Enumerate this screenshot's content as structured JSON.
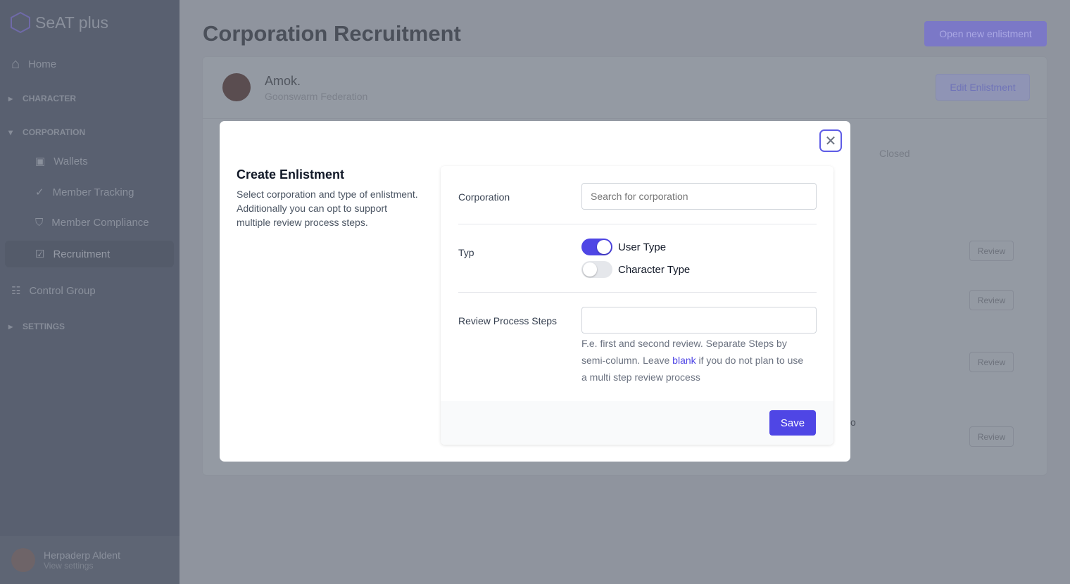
{
  "app": {
    "name": "SeAT plus",
    "accent": "#4f46e5"
  },
  "sidebar": {
    "home": "Home",
    "character": "CHARACTER",
    "corporation": "CORPORATION",
    "items": [
      {
        "label": "Wallets",
        "icon": "wallet-icon"
      },
      {
        "label": "Member Tracking",
        "icon": "badge-check-icon"
      },
      {
        "label": "Member Compliance",
        "icon": "shield-check-icon"
      },
      {
        "label": "Recruitment",
        "icon": "clipboard-check-icon"
      }
    ],
    "control_group": "Control Group",
    "settings": "SETTINGS",
    "user": {
      "name": "Herpaderp Aldent",
      "sub": "View settings"
    }
  },
  "page": {
    "title": "Corporation Recruitment",
    "open_button": "Open new enlistment",
    "corp_name": "Amok.",
    "alliance": "Goonswarm Federation",
    "edit_button": "Edit Enlistment",
    "closed_tab": "Closed",
    "review": "Review",
    "partial_text": "o"
  },
  "modal": {
    "title": "Create Enlistment",
    "description": "Select corporation and type of enlistment. Additionally you can opt to support multiple review process steps.",
    "corporation_label": "Corporation",
    "corporation_placeholder": "Search for corporation",
    "typ_label": "Typ",
    "user_type": "User Type",
    "user_type_on": true,
    "character_type": "Character Type",
    "character_type_on": false,
    "steps_label": "Review Process Steps",
    "steps_value": "",
    "help_1": "F.e. first and second review. Separate Steps by semi-column. Leave ",
    "help_link": "blank",
    "help_2": " if you do not plan to use a multi step review process",
    "save": "Save"
  }
}
